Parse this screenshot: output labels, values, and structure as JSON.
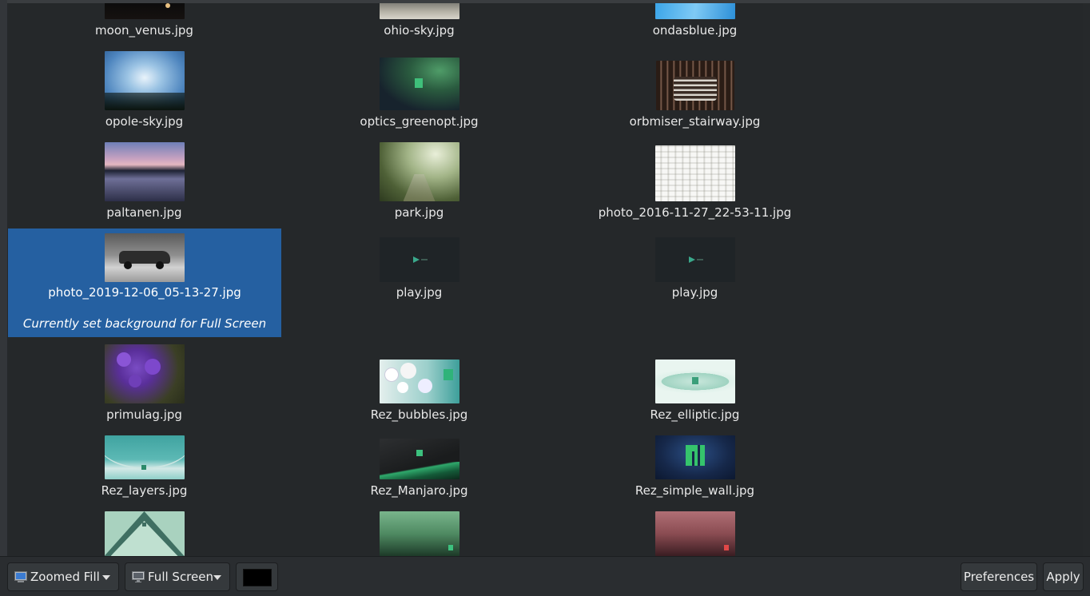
{
  "wallpapers": [
    {
      "name": "moon_venus.jpg"
    },
    {
      "name": "ohio-sky.jpg"
    },
    {
      "name": "ondasblue.jpg"
    },
    {
      "name": "opole-sky.jpg"
    },
    {
      "name": "optics_greenopt.jpg"
    },
    {
      "name": "orbmiser_stairway.jpg"
    },
    {
      "name": "paltanen.jpg"
    },
    {
      "name": "park.jpg"
    },
    {
      "name": "photo_2016-11-27_22-53-11.jpg"
    },
    {
      "name": "photo_2019-12-06_05-13-27.jpg",
      "caption": "Currently set background for Full Screen"
    },
    {
      "name": "play.jpg"
    },
    {
      "name": "play.jpg"
    },
    {
      "name": "primulag.jpg"
    },
    {
      "name": "Rez_bubbles.jpg"
    },
    {
      "name": "Rez_elliptic.jpg"
    },
    {
      "name": "Rez_layers.jpg"
    },
    {
      "name": "Rez_Manjaro.jpg"
    },
    {
      "name": "Rez_simple_wall.jpg"
    },
    {
      "name": ""
    },
    {
      "name": ""
    },
    {
      "name": ""
    }
  ],
  "toolbar": {
    "zoom_mode": "Zoomed Fill",
    "monitor": "Full Screen",
    "preferences_label": "Preferences",
    "apply_label": "Apply",
    "background_color": "#000000"
  },
  "theme": {
    "selection_color": "#2560a1"
  }
}
